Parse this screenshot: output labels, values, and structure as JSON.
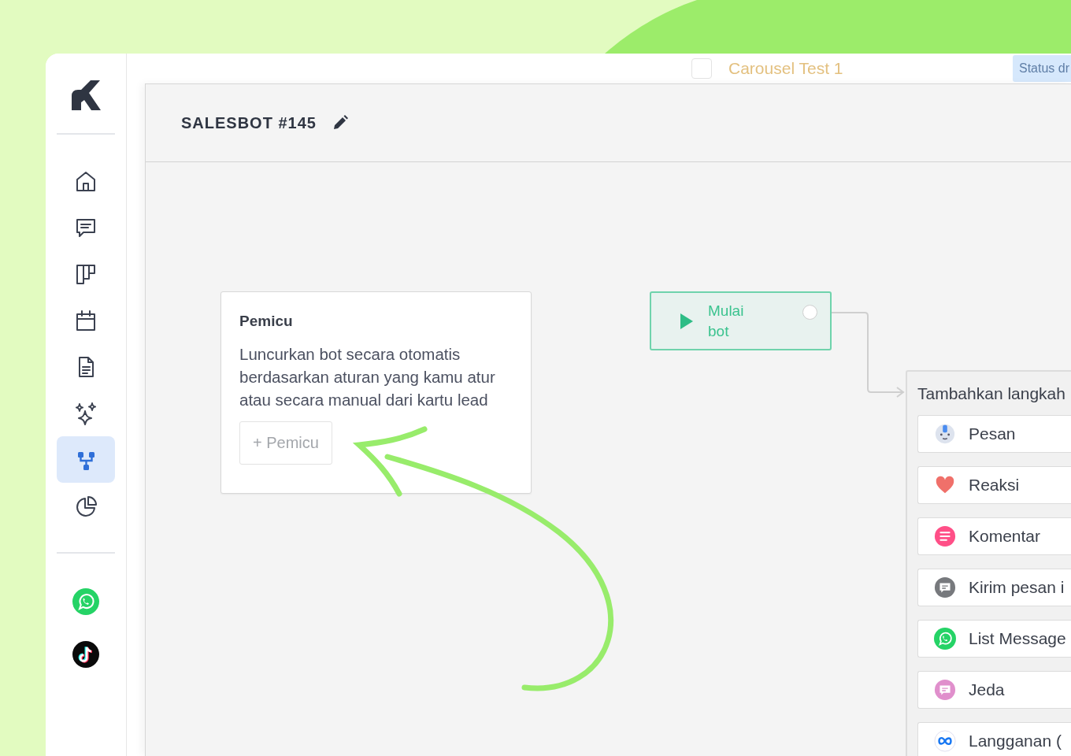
{
  "sidebar": {
    "items": [
      {
        "kind": "home",
        "selected": false
      },
      {
        "kind": "chat",
        "selected": false
      },
      {
        "kind": "board",
        "selected": false
      },
      {
        "kind": "calendar",
        "selected": false
      },
      {
        "kind": "document",
        "selected": false
      },
      {
        "kind": "sparkles",
        "selected": false
      },
      {
        "kind": "flow",
        "selected": true
      },
      {
        "kind": "pie",
        "selected": false
      }
    ],
    "channels": [
      {
        "kind": "whatsapp"
      },
      {
        "kind": "tiktok"
      }
    ]
  },
  "background_list": {
    "checked": false,
    "title": "Carousel Test 1",
    "status": "Status dr"
  },
  "editor": {
    "title": "SALESBOT #145",
    "trigger_card": {
      "title": "Pemicu",
      "description": "Luncurkan bot secara otomatis berdasarkan aturan yang kamu atur atau secara manual dari kartu lead",
      "button": "+ Pemicu"
    },
    "start_node": {
      "label": "Mulai bot"
    },
    "steps_panel": {
      "title": "Tambahkan langkah",
      "steps": [
        {
          "kind": "robot",
          "label": "Pesan"
        },
        {
          "kind": "heart",
          "label": "Reaksi"
        },
        {
          "kind": "comment",
          "label": "Komentar"
        },
        {
          "kind": "message",
          "label": "Kirim pesan i"
        },
        {
          "kind": "whatsapp",
          "label": "List Message"
        },
        {
          "kind": "pause",
          "label": "Jeda"
        },
        {
          "kind": "meta",
          "label": "Langganan ("
        }
      ]
    }
  }
}
